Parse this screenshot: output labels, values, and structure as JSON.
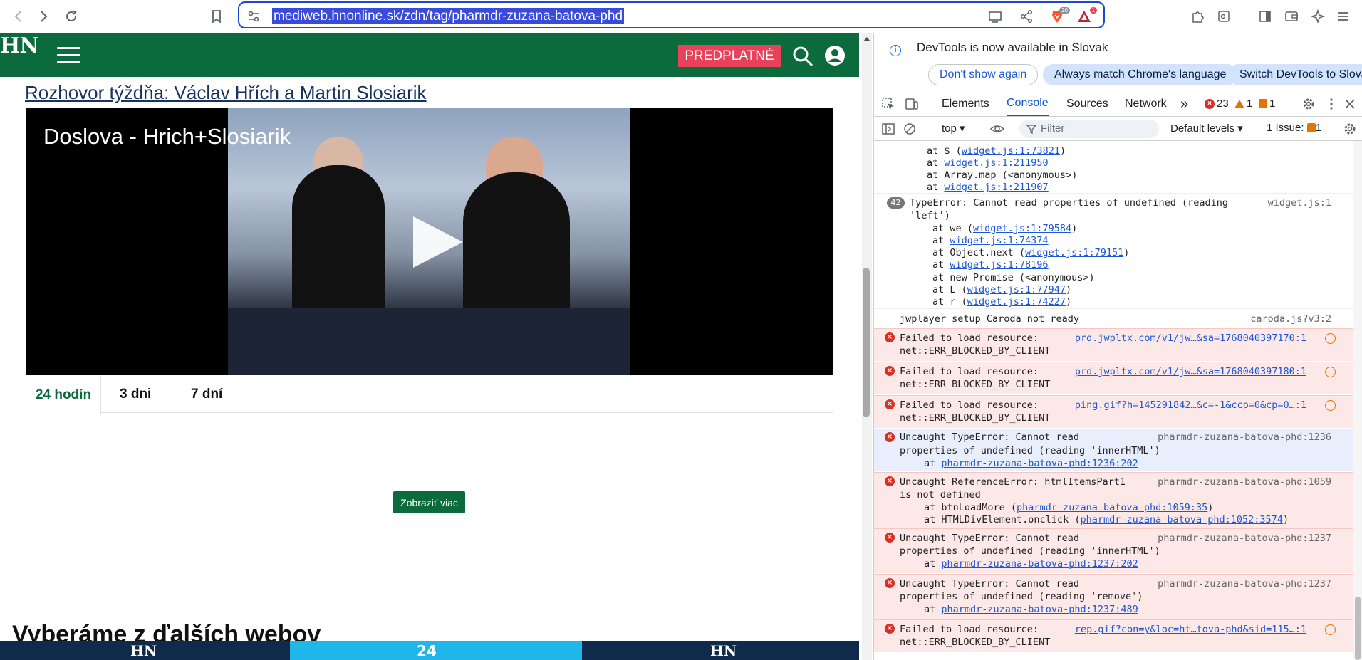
{
  "browser": {
    "url": "mediweb.hnonline.sk/zdn/tag/pharmdr-zuzana-batova-phd",
    "brave_badge": "20",
    "alert_badge": "1"
  },
  "site": {
    "logo": "HN",
    "subscribe_label": "PREDPLATNÉ",
    "article_link": "Rozhovor týždňa: Václav Hřích a Martin Slosiarik",
    "video_title": "Doslova - Hrich+Slosiarik",
    "tabs": [
      "24 hodín",
      "3 dni",
      "7 dní"
    ],
    "load_more_label": "Zobraziť viac",
    "more_heading": "Vyberáme z ďalších webov",
    "bottom_logo_1": "HN",
    "bottom_logo_2": "24",
    "bottom_logo_3": "HN"
  },
  "devtools": {
    "notice_text": "DevTools is now available in Slovak",
    "btn_dont_show": "Don't show again",
    "btn_always_match": "Always match Chrome's language",
    "btn_switch": "Switch DevTools to Slovak",
    "tabs": [
      "Elements",
      "Console",
      "Sources",
      "Network"
    ],
    "more_tabs": "»",
    "error_count": "23",
    "warning_count": "1",
    "issue_count": "1",
    "context": "top",
    "filter_placeholder": "Filter",
    "levels": "Default levels",
    "issues_label": "1 Issue:",
    "issues_num": "1"
  },
  "console": {
    "m0": {
      "l1a": "at $ (",
      "l1b": "widget.js:1:73821",
      "l1c": ")",
      "l2a": "at ",
      "l2b": "widget.js:1:211950",
      "l3": "at Array.map (<anonymous>)",
      "l4a": "at ",
      "l4b": "widget.js:1:211907"
    },
    "m1": {
      "count": "42",
      "l1": "TypeError: Cannot read properties of undefined (reading",
      "l2": "'left')",
      "src": "widget.js:1",
      "s1a": "at we (",
      "s1b": "widget.js:1:79584",
      "s1c": ")",
      "s2a": "at ",
      "s2b": "widget.js:1:74374",
      "s3a": "at Object.next (",
      "s3b": "widget.js:1:79151",
      "s3c": ")",
      "s4a": "at ",
      "s4b": "widget.js:1:78196",
      "s5": "at new Promise (<anonymous>)",
      "s6a": "at L (",
      "s6b": "widget.js:1:77947",
      "s6c": ")",
      "s7a": "at r (",
      "s7b": "widget.js:1:74227",
      "s7c": ")"
    },
    "m2": {
      "text": "jwplayer setup Caroda not ready",
      "src": "caroda.js?v3:2"
    },
    "m3": {
      "l1": "Failed to load resource:",
      "l2": "net::ERR_BLOCKED_BY_CLIENT",
      "src": "prd.jwpltx.com/v1/jw…&sa=1768040397170:1"
    },
    "m4": {
      "l1": "Failed to load resource:",
      "l2": "net::ERR_BLOCKED_BY_CLIENT",
      "src": "prd.jwpltx.com/v1/jw…&sa=1768040397180:1"
    },
    "m5": {
      "l1": "Failed to load resource:",
      "l2": "net::ERR_BLOCKED_BY_CLIENT",
      "src": "ping.gif?h=145291842…&c=-1&ccp=0&cp=0…:1"
    },
    "m6": {
      "l1": "Uncaught TypeError: Cannot read",
      "l2": "properties of undefined (reading 'innerHTML')",
      "l3a": "at ",
      "l3b": "pharmdr-zuzana-batova-phd:1236:202",
      "src": "pharmdr-zuzana-batova-phd:1236"
    },
    "m7": {
      "l1": "Uncaught ReferenceError: htmlItemsPart1",
      "l2": "is not defined",
      "l3a": "at btnLoadMore (",
      "l3b": "pharmdr-zuzana-batova-phd:1059:35",
      "l3c": ")",
      "l4a": "at HTMLDivElement.onclick (",
      "l4b": "pharmdr-zuzana-batova-phd:1052:3574",
      "l4c": ")",
      "src": "pharmdr-zuzana-batova-phd:1059"
    },
    "m8": {
      "l1": "Uncaught TypeError: Cannot read",
      "l2": "properties of undefined (reading 'innerHTML')",
      "l3a": "at ",
      "l3b": "pharmdr-zuzana-batova-phd:1237:202",
      "src": "pharmdr-zuzana-batova-phd:1237"
    },
    "m9": {
      "l1": "Uncaught TypeError: Cannot read",
      "l2": "properties of undefined (reading 'remove')",
      "l3a": "at ",
      "l3b": "pharmdr-zuzana-batova-phd:1237:489",
      "src": "pharmdr-zuzana-batova-phd:1237"
    },
    "m10": {
      "l1": "Failed to load resource:",
      "l2": "net::ERR_BLOCKED_BY_CLIENT",
      "src": "rep.gif?con=y&loc=ht…tova-phd&sid=115…:1"
    }
  },
  "colors": {
    "site_green": "#0b6b3d",
    "subscribe_red": "#e8415a",
    "url_highlight": "#3a4ad9",
    "console_error_bg": "#fce8e6"
  }
}
